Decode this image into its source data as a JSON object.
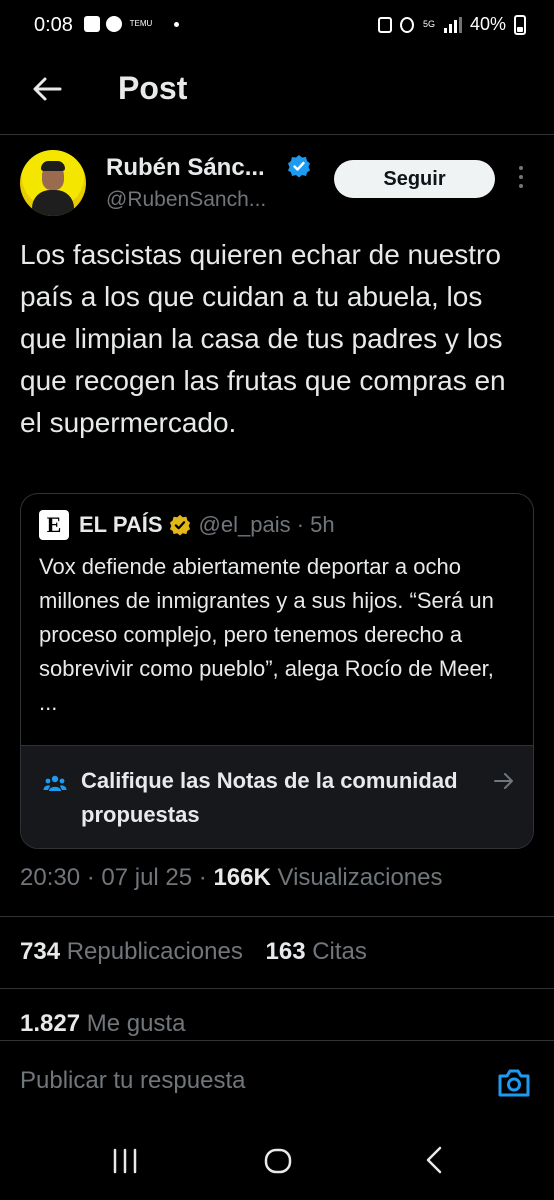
{
  "status_bar": {
    "time": "0:08",
    "temu_label": "TEMU",
    "network": "5G",
    "battery": "40%"
  },
  "header": {
    "title": "Post"
  },
  "author": {
    "name": "Rubén Sánc...",
    "handle": "@RubenSanch...",
    "follow_label": "Seguir"
  },
  "tweet": {
    "text": "Los fascistas quieren echar de nuestro país a los que cuidan a tu abuela, los que limpian la casa de tus padres y los que recogen las frutas que compras en el supermercado."
  },
  "quote": {
    "logo": "E",
    "name": "EL PAÍS",
    "handle": "@el_pais · 5h",
    "text": "Vox defiende abiertamente deportar a ocho millones de inmigrantes y a sus hijos. “Será un proceso complejo, pero tenemos derecho a sobrevivir como pueblo”, alega Rocío de Meer, ..."
  },
  "community_notes": {
    "label": "Califique las Notas de la comunidad propuestas"
  },
  "meta": {
    "datetime": "20:30 · 07 jul 25 · ",
    "views_count": "166K",
    "views_label": " Visualizaciones"
  },
  "stats": {
    "reposts_count": "734",
    "reposts_label": " Republicaciones",
    "quotes_count": "163",
    "quotes_label": " Citas",
    "likes_count": "1.827",
    "likes_label": " Me gusta"
  },
  "reply": {
    "placeholder": "Publicar tu respuesta"
  },
  "colors": {
    "background": "#000000",
    "text_primary": "#e7e9ea",
    "text_secondary": "#71767b",
    "verified_blue": "#1d9bf0",
    "verified_gold": "#e2b719"
  }
}
